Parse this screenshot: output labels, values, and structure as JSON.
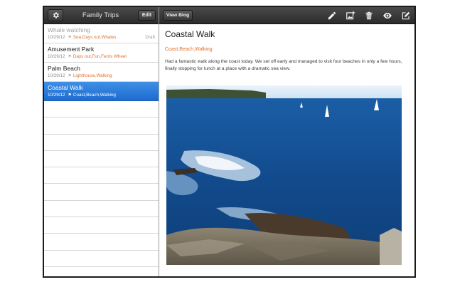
{
  "left_toolbar": {
    "title": "Family Trips",
    "edit_label": "Edit",
    "settings_icon": "gear-icon"
  },
  "posts": [
    {
      "title": "Whale watching",
      "date": "10/29/12",
      "tags": "Sea,Days out,Whales",
      "status": "Draft",
      "muted": true
    },
    {
      "title": "Amusement Park",
      "date": "10/29/12",
      "tags": "Days out,Fun,Ferris Wheel",
      "status": ""
    },
    {
      "title": "Palm Beach",
      "date": "10/29/12",
      "tags": "Lighthouse,Walking",
      "status": ""
    },
    {
      "title": "Coastal Walk",
      "date": "10/29/12",
      "tags": "Coast,Beach,Walking",
      "status": "",
      "selected": true
    }
  ],
  "right_toolbar": {
    "view_blog_label": "View Blog",
    "icons": [
      "pencil-icon",
      "add-photo-icon",
      "trash-icon",
      "eye-icon",
      "compose-icon"
    ]
  },
  "post": {
    "title": "Coastal Walk",
    "tags": "Coast,Beach,Walking",
    "body": "Had a fantastic walk along the coast today. We set off early and managed to visit four beaches in only a few hours, finally stopping for lunch at a place with a dramatic sea view.",
    "photo_description_icon": "coastal-photo"
  },
  "colors": {
    "toolbar": "#333333",
    "selection": "#2a7ddc",
    "tag": "#e0702c"
  }
}
